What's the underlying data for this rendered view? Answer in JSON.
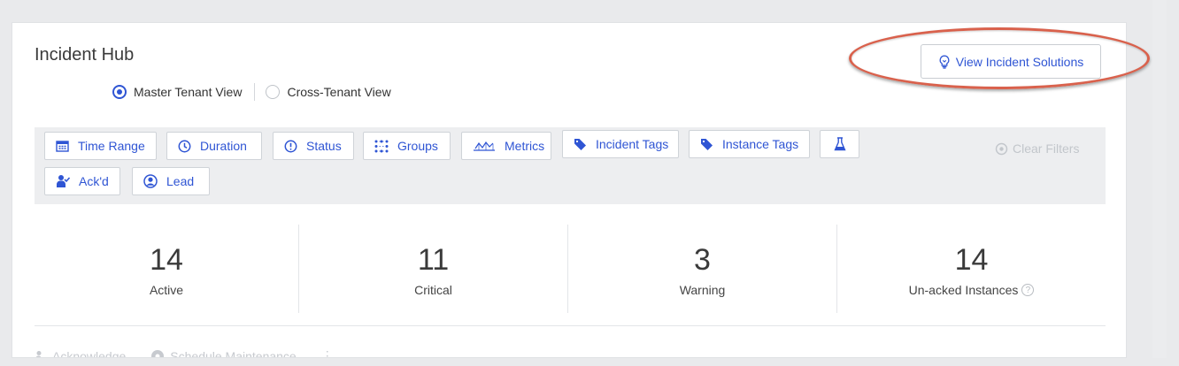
{
  "header": {
    "title": "Incident Hub",
    "view_options": [
      {
        "label": "Master Tenant View",
        "selected": true
      },
      {
        "label": "Cross-Tenant View",
        "selected": false
      }
    ],
    "solutions_button": {
      "label": "View Incident Solutions",
      "icon": "lightbulb-icon"
    }
  },
  "filters": {
    "buttons": [
      {
        "label": "Time Range",
        "icon": "calendar-icon"
      },
      {
        "label": "Duration",
        "icon": "clock-icon"
      },
      {
        "label": "Status",
        "icon": "alert-circle-icon"
      },
      {
        "label": "Groups",
        "icon": "groups-icon"
      },
      {
        "label": "Metrics",
        "icon": "metrics-icon"
      },
      {
        "label": "Incident Tags",
        "icon": "tag-icon"
      },
      {
        "label": "Instance Tags",
        "icon": "tag-icon"
      },
      {
        "label": "",
        "icon": "flask-icon"
      },
      {
        "label": "Ack'd",
        "icon": "acknowledged-user-icon"
      },
      {
        "label": "Lead",
        "icon": "user-circle-icon"
      }
    ],
    "clear_label": "Clear Filters"
  },
  "stats": [
    {
      "value": "14",
      "label": "Active"
    },
    {
      "value": "11",
      "label": "Critical"
    },
    {
      "value": "3",
      "label": "Warning"
    },
    {
      "value": "14",
      "label": "Un-acked Instances",
      "help_icon": "question-icon"
    }
  ],
  "actions": [
    {
      "label": "Acknowledge",
      "icon": "acknowledge-icon"
    },
    {
      "label": "Schedule Maintenance",
      "icon": "maintenance-icon"
    },
    {
      "label": "⋮",
      "icon": "more-icon"
    }
  ],
  "colors": {
    "accent": "#2f55d4",
    "annotation": "#d9614c",
    "filter_bar_bg": "#edeef0"
  }
}
